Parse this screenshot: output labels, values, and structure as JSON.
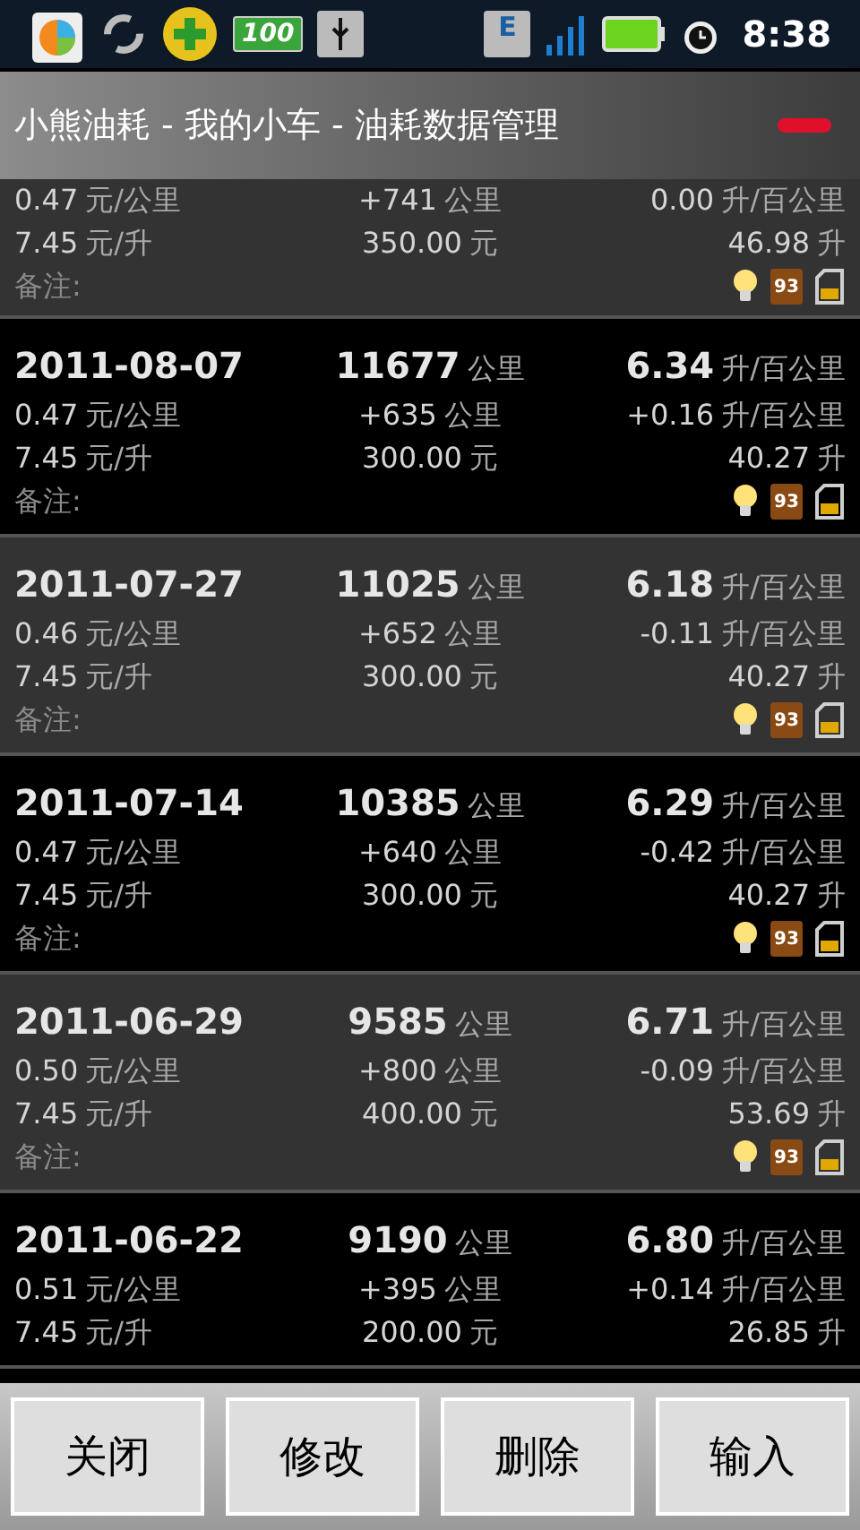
{
  "status_bar": {
    "time": "8:38",
    "battery_badge": "100",
    "network_badge": "E"
  },
  "title": "小熊油耗 - 我的小车 - 油耗数据管理",
  "records": [
    {
      "cost_per_km": {
        "value": "0.47",
        "unit": "元/公里"
      },
      "distance": {
        "value": "+741",
        "unit": "公里"
      },
      "change": {
        "value": "0.00",
        "unit": "升/百公里"
      },
      "price": {
        "value": "7.45",
        "unit": "元/升"
      },
      "amount": {
        "value": "350.00",
        "unit": "元"
      },
      "volume": {
        "value": "46.98",
        "unit": "升"
      },
      "note_label": "备注:",
      "fuel_grade": "93"
    },
    {
      "date": "2011-08-07",
      "odometer": {
        "value": "11677",
        "unit": "公里"
      },
      "consumption": {
        "value": "6.34",
        "unit": "升/百公里"
      },
      "cost_per_km": {
        "value": "0.47",
        "unit": "元/公里"
      },
      "distance": {
        "value": "+635",
        "unit": "公里"
      },
      "change": {
        "value": "+0.16",
        "unit": "升/百公里"
      },
      "price": {
        "value": "7.45",
        "unit": "元/升"
      },
      "amount": {
        "value": "300.00",
        "unit": "元"
      },
      "volume": {
        "value": "40.27",
        "unit": "升"
      },
      "note_label": "备注:",
      "fuel_grade": "93"
    },
    {
      "date": "2011-07-27",
      "odometer": {
        "value": "11025",
        "unit": "公里"
      },
      "consumption": {
        "value": "6.18",
        "unit": "升/百公里"
      },
      "cost_per_km": {
        "value": "0.46",
        "unit": "元/公里"
      },
      "distance": {
        "value": "+652",
        "unit": "公里"
      },
      "change": {
        "value": "-0.11",
        "unit": "升/百公里"
      },
      "price": {
        "value": "7.45",
        "unit": "元/升"
      },
      "amount": {
        "value": "300.00",
        "unit": "元"
      },
      "volume": {
        "value": "40.27",
        "unit": "升"
      },
      "note_label": "备注:",
      "fuel_grade": "93"
    },
    {
      "date": "2011-07-14",
      "odometer": {
        "value": "10385",
        "unit": "公里"
      },
      "consumption": {
        "value": "6.29",
        "unit": "升/百公里"
      },
      "cost_per_km": {
        "value": "0.47",
        "unit": "元/公里"
      },
      "distance": {
        "value": "+640",
        "unit": "公里"
      },
      "change": {
        "value": "-0.42",
        "unit": "升/百公里"
      },
      "price": {
        "value": "7.45",
        "unit": "元/升"
      },
      "amount": {
        "value": "300.00",
        "unit": "元"
      },
      "volume": {
        "value": "40.27",
        "unit": "升"
      },
      "note_label": "备注:",
      "fuel_grade": "93"
    },
    {
      "date": "2011-06-29",
      "odometer": {
        "value": "9585",
        "unit": "公里"
      },
      "consumption": {
        "value": "6.71",
        "unit": "升/百公里"
      },
      "cost_per_km": {
        "value": "0.50",
        "unit": "元/公里"
      },
      "distance": {
        "value": "+800",
        "unit": "公里"
      },
      "change": {
        "value": "-0.09",
        "unit": "升/百公里"
      },
      "price": {
        "value": "7.45",
        "unit": "元/升"
      },
      "amount": {
        "value": "400.00",
        "unit": "元"
      },
      "volume": {
        "value": "53.69",
        "unit": "升"
      },
      "note_label": "备注:",
      "fuel_grade": "93"
    },
    {
      "date": "2011-06-22",
      "odometer": {
        "value": "9190",
        "unit": "公里"
      },
      "consumption": {
        "value": "6.80",
        "unit": "升/百公里"
      },
      "cost_per_km": {
        "value": "0.51",
        "unit": "元/公里"
      },
      "distance": {
        "value": "+395",
        "unit": "公里"
      },
      "change": {
        "value": "+0.14",
        "unit": "升/百公里"
      },
      "price": {
        "value": "7.45",
        "unit": "元/升"
      },
      "amount": {
        "value": "200.00",
        "unit": "元"
      },
      "volume": {
        "value": "26.85",
        "unit": "升"
      }
    }
  ],
  "buttons": [
    "关闭",
    "修改",
    "删除",
    "输入"
  ]
}
